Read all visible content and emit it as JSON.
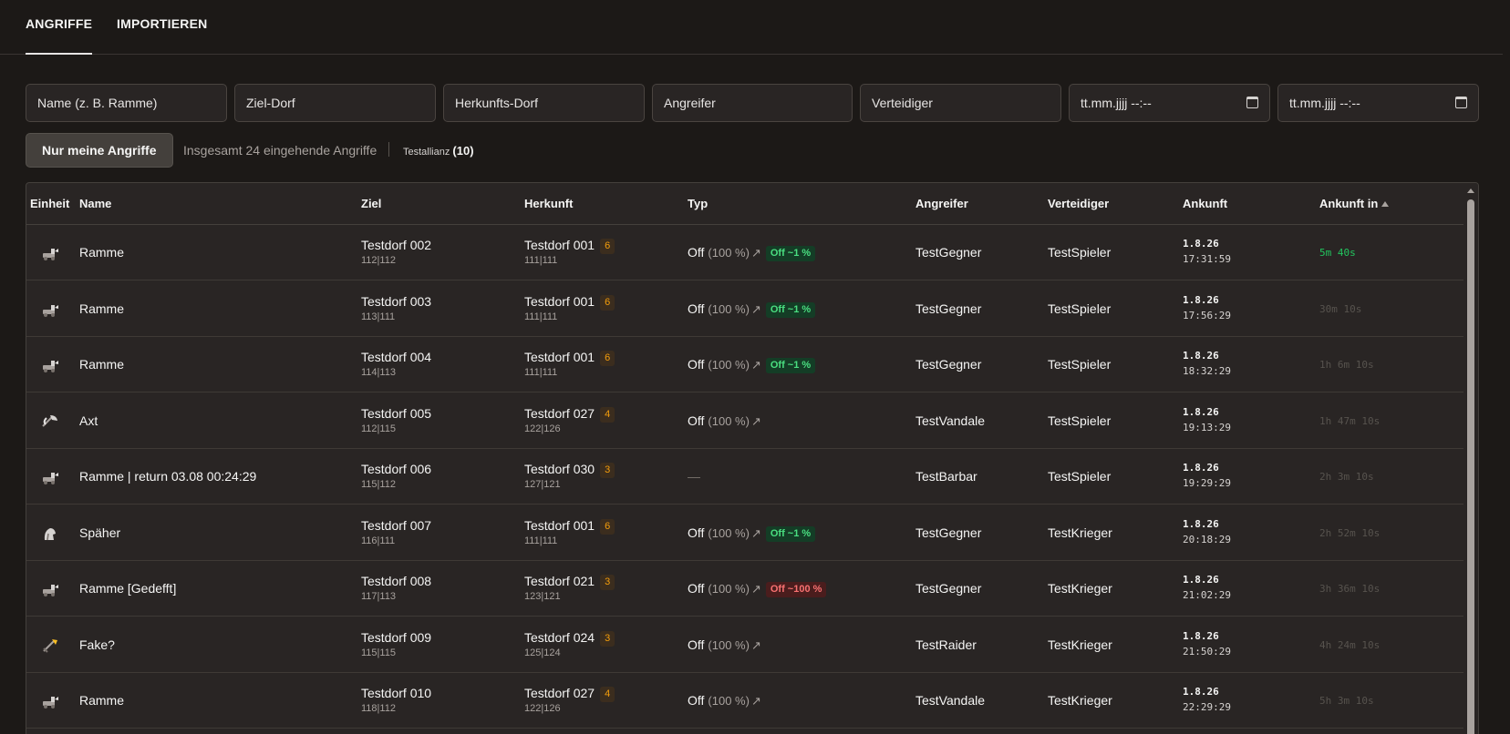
{
  "tabs": {
    "attacks": "ANGRIFFE",
    "import": "IMPORTIEREN"
  },
  "filters": {
    "name_placeholder": "Name (z. B. Ramme)",
    "target_placeholder": "Ziel-Dorf",
    "origin_placeholder": "Herkunfts-Dorf",
    "attacker_placeholder": "Angreifer",
    "defender_placeholder": "Verteidiger",
    "date_from": "tt.mm.jjjj --:--",
    "date_to": "tt.mm.jjjj --:--"
  },
  "toolbar": {
    "my_attacks_button": "Nur meine Angriffe",
    "summary": "Insgesamt 24 eingehende Angriffe",
    "alliance_name": "Testallianz",
    "alliance_count": "(10)"
  },
  "table": {
    "headers": {
      "unit": "Einheit",
      "name": "Name",
      "target": "Ziel",
      "origin": "Herkunft",
      "type": "Typ",
      "attacker": "Angreifer",
      "defender": "Verteidiger",
      "arrival": "Ankunft",
      "arrival_in": "Ankunft in"
    },
    "rows": [
      {
        "unit_icon": "ram-icon",
        "name": "Ramme",
        "target": "Testdorf 002",
        "target_coord": "112|112",
        "origin": "Testdorf 001",
        "origin_badge": "6",
        "origin_coord": "111|111",
        "type": "Off",
        "type_pct": "(100 %)",
        "type_arrow": "↗",
        "pill": "Off ~1 %",
        "pill_color": "green",
        "attacker": "TestGegner",
        "defender": "TestSpieler",
        "arrival_date": "1.8.26",
        "arrival_time": "17:31:59",
        "countdown": "5m 40s",
        "countdown_active": true
      },
      {
        "unit_icon": "ram-icon",
        "name": "Ramme",
        "target": "Testdorf 003",
        "target_coord": "113|111",
        "origin": "Testdorf 001",
        "origin_badge": "6",
        "origin_coord": "111|111",
        "type": "Off",
        "type_pct": "(100 %)",
        "type_arrow": "↗",
        "pill": "Off ~1 %",
        "pill_color": "green",
        "attacker": "TestGegner",
        "defender": "TestSpieler",
        "arrival_date": "1.8.26",
        "arrival_time": "17:56:29",
        "countdown": "30m 10s",
        "countdown_active": false
      },
      {
        "unit_icon": "ram-icon",
        "name": "Ramme",
        "target": "Testdorf 004",
        "target_coord": "114|113",
        "origin": "Testdorf 001",
        "origin_badge": "6",
        "origin_coord": "111|111",
        "type": "Off",
        "type_pct": "(100 %)",
        "type_arrow": "↗",
        "pill": "Off ~1 %",
        "pill_color": "green",
        "attacker": "TestGegner",
        "defender": "TestSpieler",
        "arrival_date": "1.8.26",
        "arrival_time": "18:32:29",
        "countdown": "1h 6m 10s",
        "countdown_active": false
      },
      {
        "unit_icon": "axe-icon",
        "name": "Axt",
        "target": "Testdorf 005",
        "target_coord": "112|115",
        "origin": "Testdorf 027",
        "origin_badge": "4",
        "origin_coord": "122|126",
        "type": "Off",
        "type_pct": "(100 %)",
        "type_arrow": "↗",
        "pill": "",
        "pill_color": "",
        "attacker": "TestVandale",
        "defender": "TestSpieler",
        "arrival_date": "1.8.26",
        "arrival_time": "19:13:29",
        "countdown": "1h 47m 10s",
        "countdown_active": false
      },
      {
        "unit_icon": "ram-icon",
        "name": "Ramme | return 03.08 00:24:29",
        "target": "Testdorf 006",
        "target_coord": "115|112",
        "origin": "Testdorf 030",
        "origin_badge": "3",
        "origin_coord": "127|121",
        "type": "—",
        "type_pct": "",
        "type_arrow": "",
        "pill": "",
        "pill_color": "",
        "attacker": "TestBarbar",
        "defender": "TestSpieler",
        "arrival_date": "1.8.26",
        "arrival_time": "19:29:29",
        "countdown": "2h 3m 10s",
        "countdown_active": false
      },
      {
        "unit_icon": "scout-icon",
        "name": "Späher",
        "target": "Testdorf 007",
        "target_coord": "116|111",
        "origin": "Testdorf 001",
        "origin_badge": "6",
        "origin_coord": "111|111",
        "type": "Off",
        "type_pct": "(100 %)",
        "type_arrow": "↗",
        "pill": "Off ~1 %",
        "pill_color": "green",
        "attacker": "TestGegner",
        "defender": "TestKrieger",
        "arrival_date": "1.8.26",
        "arrival_time": "20:18:29",
        "countdown": "2h 52m 10s",
        "countdown_active": false
      },
      {
        "unit_icon": "ram-icon",
        "name": "Ramme [Gedefft]",
        "target": "Testdorf 008",
        "target_coord": "117|113",
        "origin": "Testdorf 021",
        "origin_badge": "3",
        "origin_coord": "123|121",
        "type": "Off",
        "type_pct": "(100 %)",
        "type_arrow": "↗",
        "pill": "Off ~100 %",
        "pill_color": "red",
        "attacker": "TestGegner",
        "defender": "TestKrieger",
        "arrival_date": "1.8.26",
        "arrival_time": "21:02:29",
        "countdown": "3h 36m 10s",
        "countdown_active": false
      },
      {
        "unit_icon": "fake-icon",
        "name": "Fake?",
        "target": "Testdorf 009",
        "target_coord": "115|115",
        "origin": "Testdorf 024",
        "origin_badge": "3",
        "origin_coord": "125|124",
        "type": "Off",
        "type_pct": "(100 %)",
        "type_arrow": "↗",
        "pill": "",
        "pill_color": "",
        "attacker": "TestRaider",
        "defender": "TestKrieger",
        "arrival_date": "1.8.26",
        "arrival_time": "21:50:29",
        "countdown": "4h 24m 10s",
        "countdown_active": false
      },
      {
        "unit_icon": "ram-icon",
        "name": "Ramme",
        "target": "Testdorf 010",
        "target_coord": "118|112",
        "origin": "Testdorf 027",
        "origin_badge": "4",
        "origin_coord": "122|126",
        "type": "Off",
        "type_pct": "(100 %)",
        "type_arrow": "↗",
        "pill": "",
        "pill_color": "",
        "attacker": "TestVandale",
        "defender": "TestKrieger",
        "arrival_date": "1.8.26",
        "arrival_time": "22:29:29",
        "countdown": "5h 3m 10s",
        "countdown_active": false
      }
    ]
  }
}
